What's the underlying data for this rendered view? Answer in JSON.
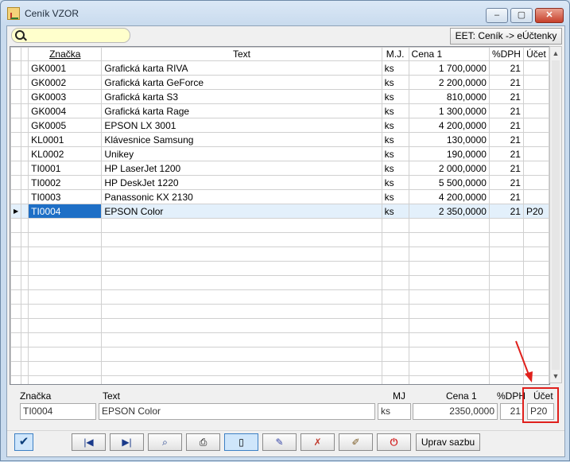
{
  "window": {
    "title": "Ceník VZOR",
    "minimize": "‒",
    "maximize": "▢",
    "close": "✕"
  },
  "search": {
    "value": ""
  },
  "eet_button": "EET: Ceník -> eÚčtenky",
  "columns": [
    "Značka",
    "Text",
    "M.J.",
    "Cena 1",
    "%DPH",
    "Účet"
  ],
  "rows": [
    {
      "znacka": "GK0001",
      "text": "Grafická karta RIVA",
      "mj": "ks",
      "cena": "1 700,0000",
      "dph": "21",
      "ucet": ""
    },
    {
      "znacka": "GK0002",
      "text": "Grafická karta GeForce",
      "mj": "ks",
      "cena": "2 200,0000",
      "dph": "21",
      "ucet": ""
    },
    {
      "znacka": "GK0003",
      "text": "Grafická karta S3",
      "mj": "ks",
      "cena": "810,0000",
      "dph": "21",
      "ucet": ""
    },
    {
      "znacka": "GK0004",
      "text": "Grafická karta Rage",
      "mj": "ks",
      "cena": "1 300,0000",
      "dph": "21",
      "ucet": ""
    },
    {
      "znacka": "GK0005",
      "text": "EPSON LX 3001",
      "mj": "ks",
      "cena": "4 200,0000",
      "dph": "21",
      "ucet": ""
    },
    {
      "znacka": "KL0001",
      "text": "Klávesnice Samsung",
      "mj": "ks",
      "cena": "130,0000",
      "dph": "21",
      "ucet": ""
    },
    {
      "znacka": "KL0002",
      "text": "Unikey",
      "mj": "ks",
      "cena": "190,0000",
      "dph": "21",
      "ucet": ""
    },
    {
      "znacka": "TI0001",
      "text": "HP LaserJet 1200",
      "mj": "ks",
      "cena": "2 000,0000",
      "dph": "21",
      "ucet": ""
    },
    {
      "znacka": "TI0002",
      "text": "HP DeskJet 1220",
      "mj": "ks",
      "cena": "5 500,0000",
      "dph": "21",
      "ucet": ""
    },
    {
      "znacka": "TI0003",
      "text": "Panassonic KX 2130",
      "mj": "ks",
      "cena": "4 200,0000",
      "dph": "21",
      "ucet": ""
    },
    {
      "znacka": "TI0004",
      "text": "EPSON Color",
      "mj": "ks",
      "cena": "2 350,0000",
      "dph": "21",
      "ucet": "P20"
    }
  ],
  "selected_row": 10,
  "empty_row_count": 12,
  "detail": {
    "labels": {
      "znacka": "Značka",
      "text": "Text",
      "mj": "MJ",
      "cena": "Cena 1",
      "dph": "%DPH",
      "ucet": "Účet"
    },
    "values": {
      "znacka": "TI0004",
      "text": "EPSON Color",
      "mj": "ks",
      "cena": "2350,0000",
      "dph": "21",
      "ucet": "P20"
    }
  },
  "toolbar": {
    "uprav_sazbu": "Uprav sazbu"
  },
  "colors": {
    "highlight": "#e0201c",
    "selection": "#1e6fc6"
  }
}
